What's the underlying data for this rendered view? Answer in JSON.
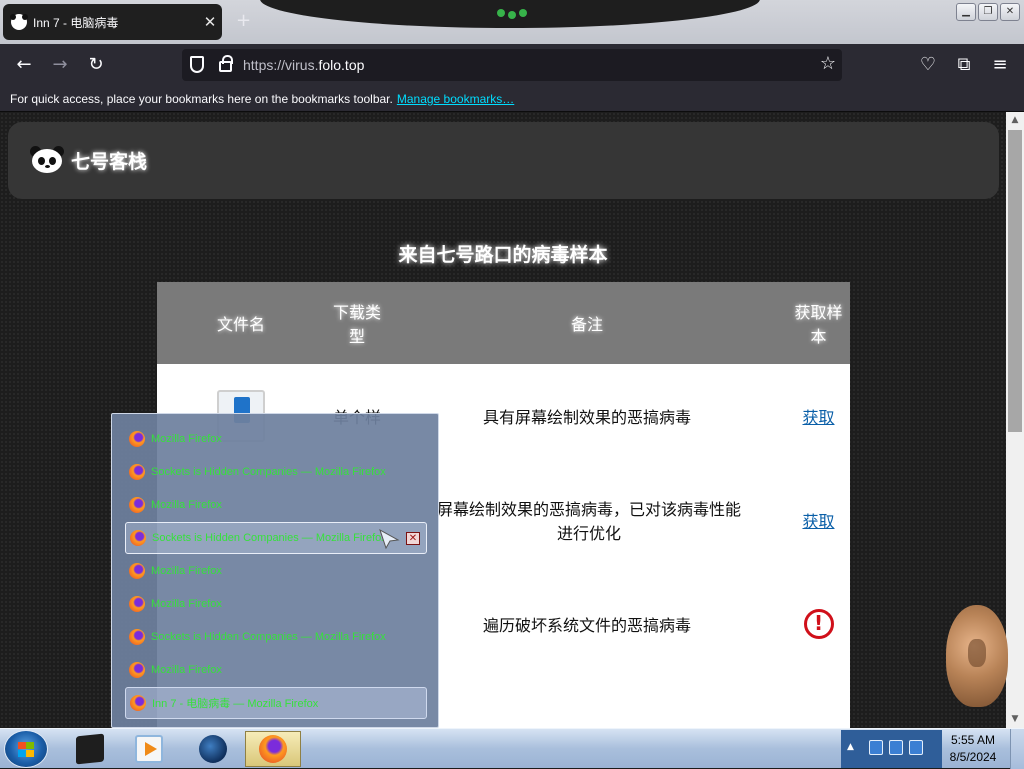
{
  "browser": {
    "tab_title": "Inn 7 - 电脑病毒",
    "tab_close": "✕",
    "new_tab": "+",
    "url_prefix": "https://virus.",
    "url_domain": "folo.top",
    "bookmarks_text": "For quick access, place your bookmarks here on the bookmarks toolbar.",
    "bookmarks_link": "Manage bookmarks…"
  },
  "page": {
    "site_name": "七号客栈",
    "title": "来自七号路口的病毒样本",
    "table": {
      "headers": [
        "文件名",
        "下载类型",
        "备注",
        "获取样本"
      ],
      "rows": [
        {
          "type": "单个样",
          "note": "具有屏幕绘制效果的恶搞病毒",
          "action": "获取",
          "action_kind": "link"
        },
        {
          "type": "",
          "note": "屏幕绘制效果的恶搞病毒，已对该病毒性能进行优化",
          "action": "获取",
          "action_kind": "link"
        },
        {
          "type": "",
          "note": "遍历破坏系统文件的恶搞病毒",
          "action": "!",
          "action_kind": "alert"
        }
      ]
    }
  },
  "taskbar_popup": {
    "items": [
      "Mozilla Firefox",
      "Sockets is Hidden Companies — Mozilla Firefox",
      "Mozilla Firefox",
      "Sockets is Hidden Companies — Mozilla Firefox",
      "Mozilla Firefox",
      "Mozilla Firefox",
      "Sockets is Hidden Companies — Mozilla Firefox",
      "Mozilla Firefox",
      "Inn 7 - 电脑病毒 — Mozilla Firefox"
    ],
    "close_glyph": "✕"
  },
  "taskbar": {
    "time": "5:55 AM",
    "date": "8/5/2024",
    "tray_arrow": "▲"
  },
  "colors": {
    "popup_text": "#36e13c",
    "link": "#0a5fa8",
    "alert": "#d0101a",
    "table_header": "#7a7a7a"
  },
  "icons": [
    "panda-logo-icon",
    "shield-icon",
    "lock-icon",
    "star-icon",
    "firefox-icon",
    "windows-start-icon",
    "alert-icon"
  ]
}
